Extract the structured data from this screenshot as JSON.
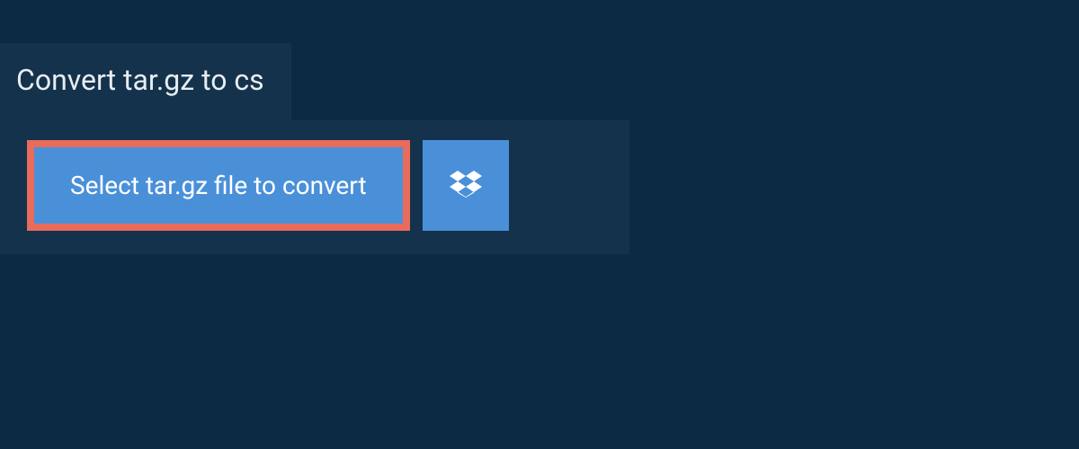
{
  "tab": {
    "title": "Convert tar.gz to cs"
  },
  "panel": {
    "select_label": "Select tar.gz file to convert"
  }
}
